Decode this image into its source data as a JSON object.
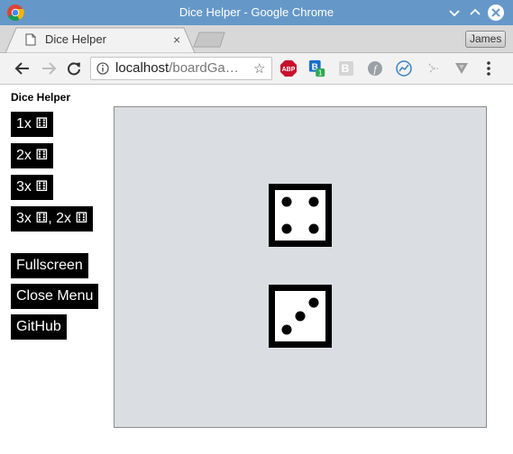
{
  "window": {
    "title": "Dice Helper - Google Chrome"
  },
  "tabs": [
    {
      "label": "Dice Helper",
      "close": "×"
    }
  ],
  "profile": {
    "name": "James"
  },
  "toolbar": {
    "url_host": "localhost",
    "url_path": "/boardGa…",
    "star": "☆",
    "abp_label": "ABP",
    "badge_count": "1"
  },
  "menu": {
    "title": "Dice Helper",
    "dice_glyph": "⚅",
    "items": [
      {
        "label": "1x ⚅"
      },
      {
        "label": "2x ⚅"
      },
      {
        "label": "3x ⚅"
      },
      {
        "label": "3x ⚅, 2x ⚅"
      }
    ],
    "actions": [
      {
        "label": "Fullscreen"
      },
      {
        "label": "Close Menu"
      },
      {
        "label": "GitHub"
      }
    ]
  },
  "dice": [
    {
      "value": 4
    },
    {
      "value": 3
    }
  ],
  "colors": {
    "titlebar": "#6598c8",
    "board": "#dadee2",
    "button_bg": "#000000",
    "button_fg": "#ffffff"
  }
}
